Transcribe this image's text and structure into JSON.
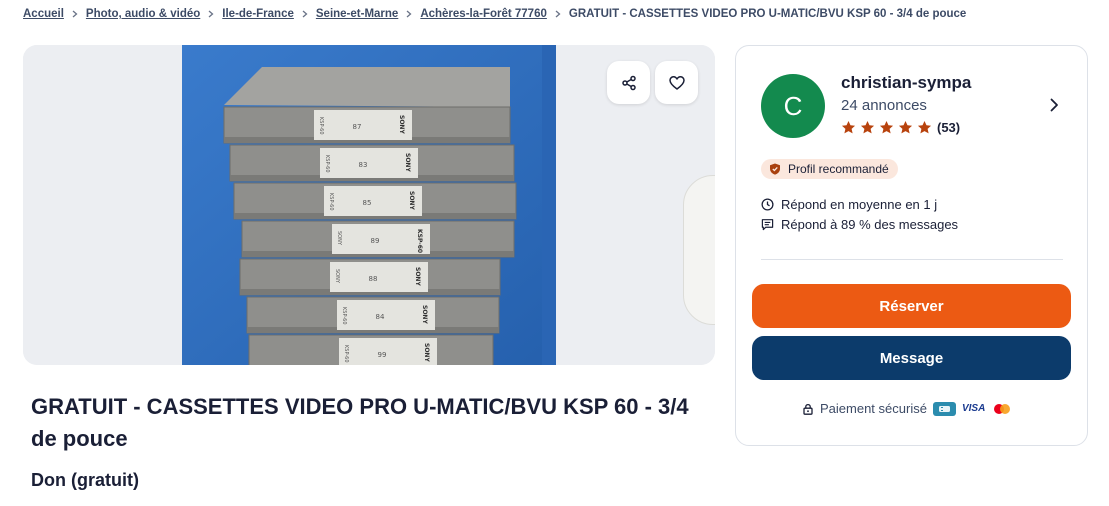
{
  "breadcrumb": {
    "items": [
      "Accueil",
      "Photo, audio & vidéo",
      "Ile-de-France",
      "Seine-et-Marne",
      "Achères-la-Forêt 77760"
    ],
    "current": "GRATUIT - CASSETTES VIDEO PRO U-MATIC/BVU KSP 60 - 3/4 de pouce"
  },
  "gallery": {
    "image_description_icon": "photo",
    "share_icon": "share-icon",
    "favorite_icon": "heart-icon",
    "tapes": [
      {
        "label": "87",
        "spine_left": "KSP-60",
        "brand": "SONY"
      },
      {
        "label": "83",
        "spine_left": "KSP-60",
        "brand": "SONY"
      },
      {
        "label": "85",
        "spine_left": "KSP-60",
        "brand": "SONY"
      },
      {
        "label": "89",
        "spine_left": "SONY",
        "brand": "KSP-60"
      },
      {
        "label": "88",
        "spine_left": "SONY",
        "brand": "SONY"
      },
      {
        "label": "84",
        "spine_left": "KSP-60",
        "brand": "SONY"
      },
      {
        "label": "99",
        "spine_left": "KSP-60",
        "brand": "SONY"
      }
    ]
  },
  "ad": {
    "title": "GRATUIT - CASSETTES VIDEO PRO U-MATIC/BVU KSP 60 - 3/4 de pouce",
    "price": "Don (gratuit)"
  },
  "seller": {
    "initial": "C",
    "name": "christian-sympa",
    "ads_count": "24 annonces",
    "rating_stars": 5,
    "rating_count": "(53)",
    "badge": "Profil recommandé",
    "response_time": "Répond en moyenne en 1 j",
    "response_rate": "Répond à 89 % des messages",
    "avatar_color": "#138a4e"
  },
  "actions": {
    "reserve_label": "Réserver",
    "message_label": "Message",
    "reserve_color": "#ec5a13",
    "message_color": "#0c3b6b"
  },
  "payment": {
    "label": "Paiement sécurisé",
    "cards": [
      "CB",
      "VISA",
      "Mastercard"
    ],
    "visa_text": "VISA"
  }
}
